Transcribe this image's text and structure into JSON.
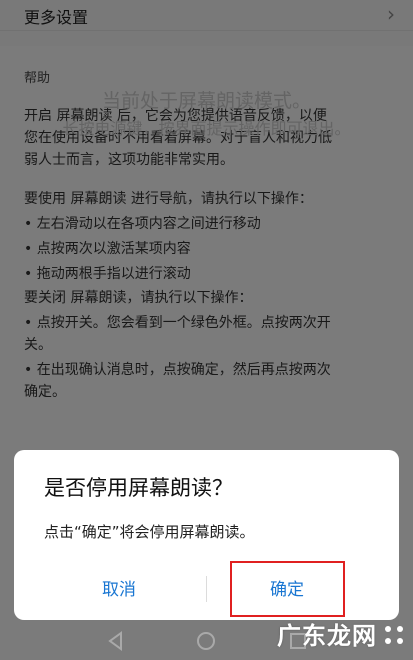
{
  "more_settings": {
    "label": "更多设置",
    "chevron": "chevron-right-icon"
  },
  "help": {
    "title": "帮助",
    "intro_lines": [
      "开启 屏幕朗读 后，它会为您提供语音反馈，以便",
      "您在使用设备时不用看着屏幕。对于盲人和视力低",
      "弱人士而言，这项功能非常实用。"
    ],
    "nav_lines": [
      "要使用 屏幕朗读 进行导航，请执行以下操作：",
      "• 左右滑动以在各项内容之间进行移动",
      "• 点按两次以激活某项内容",
      "• 拖动两根手指以进行滚动"
    ],
    "off_lines": [
      "要关闭 屏幕朗读，请执行以下操作：",
      "• 点按开关。您会看到一个绿色外框。点按两次开",
      "关。",
      "• 在出现确认消息时，点按确定，然后再点按两次",
      "确定。"
    ]
  },
  "toast": {
    "line1": "当前处于屏幕朗读模式。",
    "line2": "长按电源键，按界面提示操作即可退出。"
  },
  "dialog": {
    "title": "是否停用屏幕朗读？",
    "message": "点击“确定”将会停用屏幕朗读。",
    "cancel_label": "取消",
    "ok_label": "确定"
  },
  "colors": {
    "accent": "#1976d2",
    "highlight": "#e02020"
  },
  "watermark": {
    "text": "广东龙网"
  }
}
